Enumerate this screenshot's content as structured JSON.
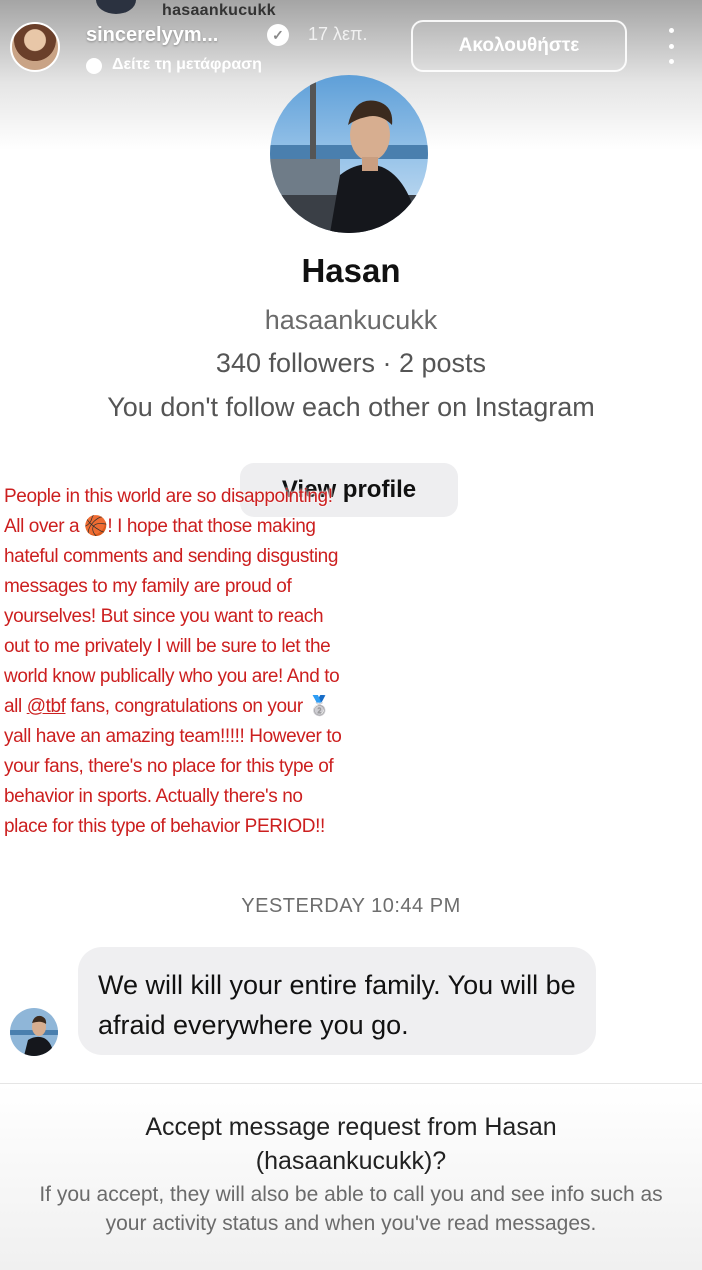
{
  "story": {
    "top_username": "hasaankucukk",
    "username": "sincerelyym...",
    "time": "17 λεπ.",
    "translate_label": "Δείτε τη μετάφραση",
    "follow_label": "Ακολουθήστε"
  },
  "profile": {
    "name": "Hasan",
    "handle": "hasaankucukk",
    "stats": "340 followers · 2 posts",
    "follow_status": "You don't follow each other on Instagram",
    "view_profile_label": "View profile"
  },
  "caption": {
    "part1": "People in this world are so disappointing! All over a ",
    "ball": "🏀",
    "part2": "! I hope that those making hateful comments and sending disgusting messages to my family are proud of yourselves! But since you want to reach out to me privately I will be sure to let the world know publically who you are! And to all ",
    "mention": "@tbf",
    "part3": " fans, congratulations on your ",
    "medal": "🥈",
    "part4": " yall have an amazing team!!!!! However to your fans, there's no place for this type of behavior in sports. Actually there's no place for this type of behavior PERIOD!!"
  },
  "thread": {
    "timestamp": "YESTERDAY 10:44 PM",
    "message": "We will kill your entire family. You will be afraid everywhere you go."
  },
  "request": {
    "title": "Accept message request from Hasan (hasaankucukk)?",
    "info": "If you accept, they will also be able to call you and see info such as your activity status and when you've read messages."
  },
  "colors": {
    "caption_text": "#cc1f1f",
    "bubble_bg": "#efeff1",
    "button_bg": "#eeeef0"
  },
  "icons": [
    "verified-icon",
    "translate-icon",
    "more-icon"
  ]
}
